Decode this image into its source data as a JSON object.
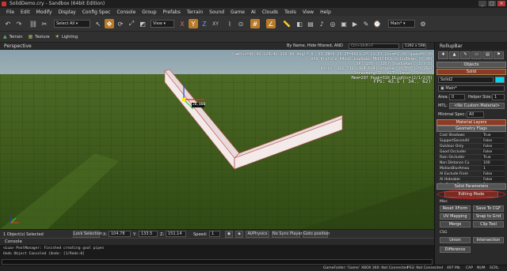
{
  "window": {
    "title": "SolidDemo.cry - Sandbox (64bit Edition)",
    "minimize": "_",
    "maximize": "□",
    "close": "×"
  },
  "menu": [
    "File",
    "Edit",
    "Modify",
    "Display",
    "Config Spec",
    "Console",
    "Group",
    "Prefabs",
    "Terrain",
    "Sound",
    "Game",
    "AI",
    "Clouds",
    "Tools",
    "View",
    "Help"
  ],
  "toolbar": {
    "select_filter": "Select All",
    "coord_system": "View",
    "axis_x": "X",
    "axis_y": "Y",
    "axis_z": "Z",
    "axis_xy": "XY",
    "layer": "Main*"
  },
  "toolbar2": {
    "terrain": "Terrain",
    "texture": "Texture",
    "lighting": "Lighting"
  },
  "viewport": {
    "title": "Perspective",
    "filter": "By Name, Hide filtered, AND",
    "search_placeholder": "Ctrl+Shift+F",
    "resolution": "1392 x 598",
    "stats": "CamPos=96.42 124.42 110.88 Angl= 0  53 ZN=0.25 ZF=4021 Z=-29.67 Zoom=1.00 Speed=0.00\nDX9 Profile 64bit LowSpec MGPU DX9 SolidDemo (0.34)\nDP: 195 ( 195) ShadowGen: 3 ( 3)\nPolys: 122,712 (124,894) Shadow: 0,767 ( 0,742)\nStreaming IO: ACT: 1msec, Jobs: 0\nMem=297 Peak=310 DLights=(2/1/2/0)",
    "fps": "FPS: 43.5 ( 34.. 62)",
    "dimension_label": "20,000"
  },
  "rollup": {
    "title": "RollupBar",
    "objects_label": "Objects",
    "solid_label": "Solid",
    "name_value": "Solid2",
    "layer_value": "Main*",
    "area_label": "Area:",
    "area_value": "0",
    "helper_size_label": "Helper Size:",
    "helper_size_value": "1",
    "mtl_label": "MTL:",
    "mtl_value": "<No Custom Material>",
    "minspec_label": "Minimal Spec:",
    "minspec_value": "All",
    "material_layers": "Material Layers",
    "geometry_flags": "Geometry Flags",
    "flags": [
      {
        "key": "Cast Shadows",
        "value": "True"
      },
      {
        "key": "SupportSecondV",
        "value": "False"
      },
      {
        "key": "Outdoor Only",
        "value": "False"
      },
      {
        "key": "Good Occluder",
        "value": "False"
      },
      {
        "key": "Rain Occluder",
        "value": "True"
      },
      {
        "key": "Non Distance Cu",
        "value": "100"
      },
      {
        "key": "MotionBlurAmou",
        "value": "1"
      },
      {
        "key": "AI Exclude From",
        "value": "False"
      },
      {
        "key": "AI Hideable",
        "value": "False"
      },
      {
        "key": "No Static Decals",
        "value": "False"
      }
    ],
    "solid_parameters": "Solid Parameters",
    "editing_mode": "Editing Mode",
    "misc_label": "Misc",
    "reset_xform": "Reset XForm",
    "save_to_cgf": "Save To CGF",
    "uv_mapping": "UV Mapping",
    "snap_to_grid": "Snap to Grid",
    "merge": "Merge",
    "clip_tool": "Clip Tool",
    "csg_label": "CSG",
    "union": "Union",
    "intersection": "Intersection",
    "difference": "Difference"
  },
  "status": {
    "selected": "1 Object(s) Selected",
    "lock_selection": "Lock Selection",
    "x_label": "X:",
    "x_value": "104.78",
    "y_label": "Y:",
    "y_value": "133.5",
    "z_label": "Z:",
    "z_value": "151.14",
    "speed_label": "Speed:",
    "speed_value": "1",
    "ai_physics": "AI/Physics",
    "no_sync_player": "No Sync Player",
    "goto_position": "Goto position"
  },
  "console": {
    "title": "Console",
    "lines": [
      "<Lua> PoolManager: Finished creating goal pipes",
      "Undo Object Canceled (Undo: [1/Redo:0]"
    ]
  },
  "bottombar": {
    "gamefolder": "GameFolder: 'Game'",
    "xbox": "XBOX 360: Not Connected",
    "ps3": "PS3: Not Connected",
    "mem": "497 Mb",
    "cap": "CAP",
    "num": "NUM",
    "scrl": "SCRL"
  },
  "colors": {
    "accent": "#b97b2a",
    "highlight_ellipse": "#e02020",
    "color_swatch": "#00d8f0"
  }
}
